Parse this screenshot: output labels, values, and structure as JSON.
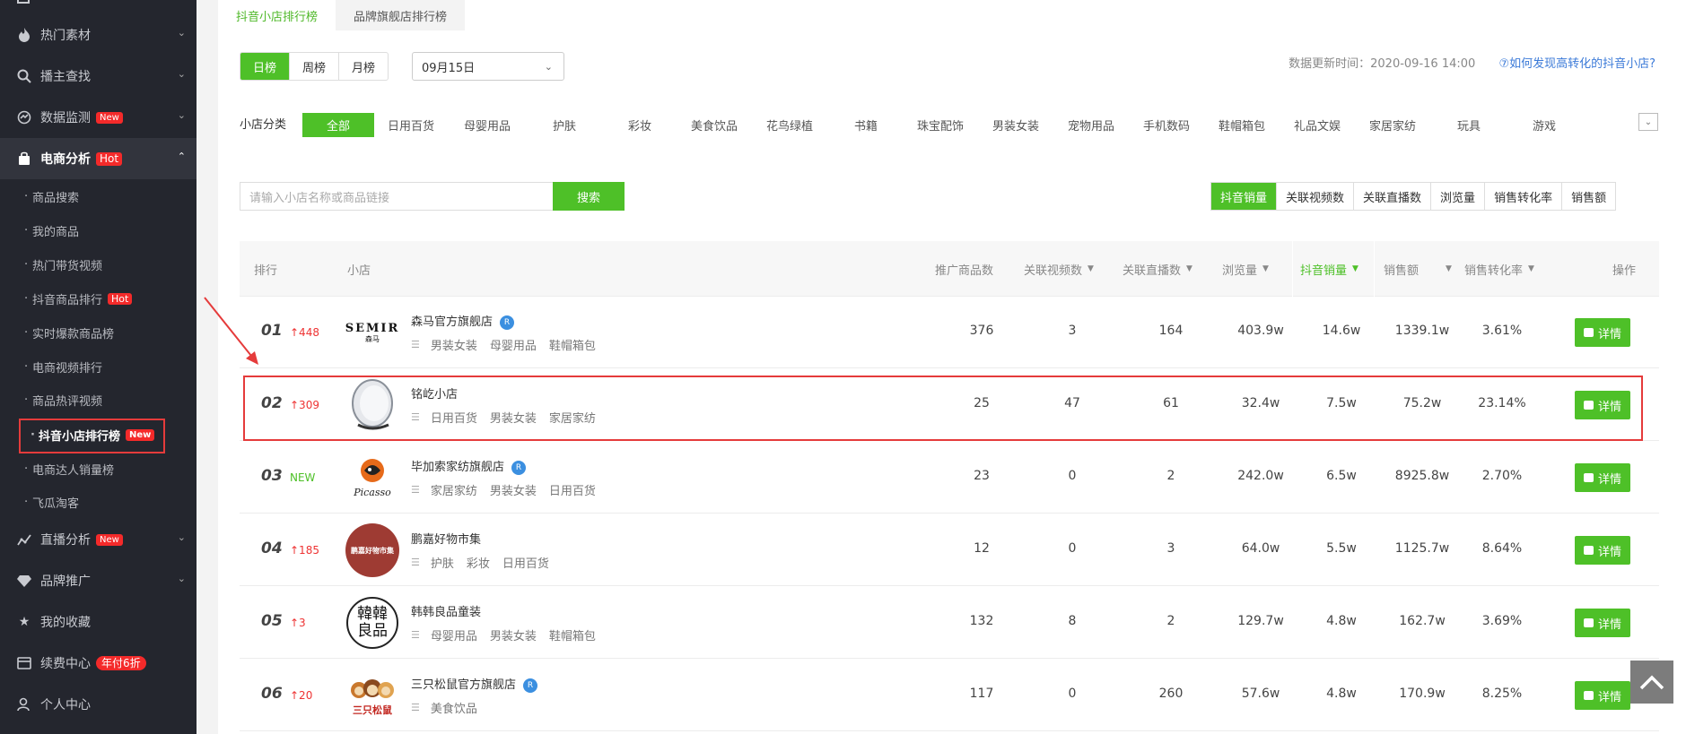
{
  "sidebar": {
    "items": [
      {
        "label": "热门素材",
        "icon": "fire-icon"
      },
      {
        "label": "播主查找",
        "icon": "search-icon"
      },
      {
        "label": "数据监测",
        "icon": "monitor-icon",
        "badge": "New"
      },
      {
        "label": "电商分析",
        "icon": "bag-icon",
        "badge": "Hot"
      },
      {
        "label": "直播分析",
        "icon": "chart-line-icon",
        "badge": "New"
      },
      {
        "label": "品牌推广",
        "icon": "diamond-icon"
      },
      {
        "label": "我的收藏",
        "icon": "star-icon"
      },
      {
        "label": "续费中心",
        "icon": "card-icon",
        "badge": "年付6折"
      },
      {
        "label": "个人中心",
        "icon": "user-icon"
      }
    ],
    "sub_items": [
      {
        "label": "商品搜索"
      },
      {
        "label": "我的商品"
      },
      {
        "label": "热门带货视频"
      },
      {
        "label": "抖音商品排行",
        "badge": "Hot"
      },
      {
        "label": "实时爆款商品榜"
      },
      {
        "label": "电商视频排行"
      },
      {
        "label": "商品热评视频"
      },
      {
        "label": "抖音小店排行榜",
        "badge": "New"
      },
      {
        "label": "电商达人销量榜"
      },
      {
        "label": "飞瓜淘客"
      }
    ]
  },
  "top_tabs": [
    "抖音小店排行榜",
    "品牌旗舰店排行榜"
  ],
  "period_tabs": [
    "日榜",
    "周榜",
    "月榜"
  ],
  "date_select": "09月15日",
  "update_time": "数据更新时间：2020-09-16 14:00",
  "help_link": "⑦如何发现高转化的抖音小店?",
  "category_label": "小店分类",
  "categories": [
    "全部",
    "日用百货",
    "母婴用品",
    "护肤",
    "彩妆",
    "美食饮品",
    "花鸟绿植",
    "书籍",
    "珠宝配饰",
    "男装女装",
    "宠物用品",
    "手机数码",
    "鞋帽箱包",
    "礼品文娱",
    "家居家纺",
    "玩具",
    "游戏"
  ],
  "search": {
    "placeholder": "请输入小店名称或商品链接",
    "button": "搜索"
  },
  "sort_buttons": [
    "抖音销量",
    "关联视频数",
    "关联直播数",
    "浏览量",
    "销售转化率",
    "销售额"
  ],
  "table": {
    "headers": {
      "rank": "排行",
      "shop": "小店",
      "products": "推广商品数",
      "videos": "关联视频数",
      "lives": "关联直播数",
      "views": "浏览量",
      "sales": "抖音销量",
      "revenue": "销售额",
      "conversion": "销售转化率",
      "action": "操作"
    },
    "detail_label": "详情",
    "rows": [
      {
        "rank": "01",
        "change": "↑448",
        "name": "森马官方旗舰店",
        "verified": "R",
        "tags": [
          "男装女装",
          "母婴用品",
          "鞋帽箱包"
        ],
        "products": "376",
        "videos": "3",
        "lives": "164",
        "views": "403.9w",
        "sales": "14.6w",
        "revenue": "1339.1w",
        "conversion": "3.61%",
        "logo_text": "SEMIR",
        "logo_sub": "森马"
      },
      {
        "rank": "02",
        "change": "↑309",
        "name": "铭屹小店",
        "verified": "",
        "tags": [
          "日用百货",
          "男装女装",
          "家居家纺"
        ],
        "products": "25",
        "videos": "47",
        "lives": "61",
        "views": "32.4w",
        "sales": "7.5w",
        "revenue": "75.2w",
        "conversion": "23.14%"
      },
      {
        "rank": "03",
        "change": "NEW",
        "name": "毕加索家纺旗舰店",
        "verified": "R",
        "tags": [
          "家居家纺",
          "男装女装",
          "日用百货"
        ],
        "products": "23",
        "videos": "0",
        "lives": "2",
        "views": "242.0w",
        "sales": "6.5w",
        "revenue": "8925.8w",
        "conversion": "2.70%",
        "logo_text": "Picasso"
      },
      {
        "rank": "04",
        "change": "↑185",
        "name": "鹏嘉好物市集",
        "verified": "",
        "tags": [
          "护肤",
          "彩妆",
          "日用百货"
        ],
        "products": "12",
        "videos": "0",
        "lives": "3",
        "views": "64.0w",
        "sales": "5.5w",
        "revenue": "1125.7w",
        "conversion": "8.64%",
        "logo_text": "鹏嘉好物市集"
      },
      {
        "rank": "05",
        "change": "↑3",
        "name": "韩韩良品童装",
        "verified": "",
        "tags": [
          "母婴用品",
          "男装女装",
          "鞋帽箱包"
        ],
        "products": "132",
        "videos": "8",
        "lives": "2",
        "views": "129.7w",
        "sales": "4.8w",
        "revenue": "162.7w",
        "conversion": "3.69%",
        "logo_text": "韓韓良品"
      },
      {
        "rank": "06",
        "change": "↑20",
        "name": "三只松鼠官方旗舰店",
        "verified": "R",
        "tags": [
          "美食饮品"
        ],
        "products": "117",
        "videos": "0",
        "lives": "260",
        "views": "57.6w",
        "sales": "4.8w",
        "revenue": "170.9w",
        "conversion": "8.25%",
        "logo_text": "三只松鼠"
      }
    ]
  },
  "colors": {
    "accent": "#4ec028",
    "highlight_border": "#e53b3b",
    "sidebar_bg": "#24262e",
    "badge": "#f42a2a"
  }
}
